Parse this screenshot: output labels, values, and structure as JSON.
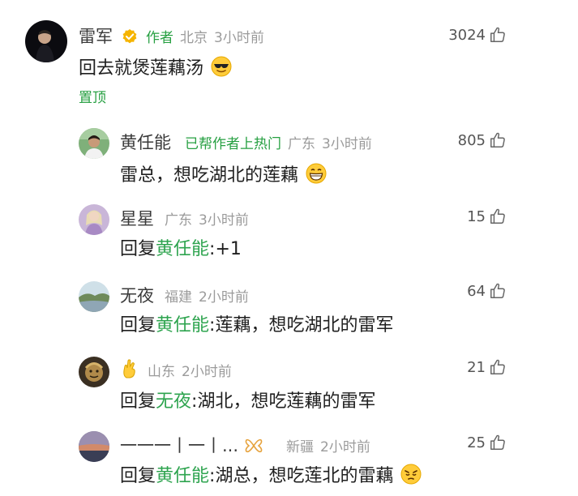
{
  "comments": [
    {
      "name": "雷军",
      "tag": "作者",
      "location": "北京",
      "time": "3小时前",
      "text": "回去就煲莲藕汤",
      "likes": "3024",
      "pin": "置顶"
    },
    {
      "name": "黄任能",
      "tag": "已帮作者上热门",
      "location": "广东",
      "time": "3小时前",
      "text": "雷总，想吃湖北的莲藕",
      "likes": "805"
    },
    {
      "name": "星星",
      "location": "广东",
      "time": "3小时前",
      "reply_prefix": "回复",
      "reply_to": "黄任能",
      "reply_text": ":+1",
      "likes": "15"
    },
    {
      "name": "无夜",
      "location": "福建",
      "time": "2小时前",
      "reply_prefix": "回复",
      "reply_to": "黄任能",
      "reply_text": ":莲藕，想吃湖北的雷军",
      "likes": "64"
    },
    {
      "name": "",
      "location": "山东",
      "time": "2小时前",
      "reply_prefix": "回复",
      "reply_to": "无夜",
      "reply_text": ":湖北，想吃莲藕的雷军",
      "likes": "21"
    },
    {
      "name": "一一一丨一丨...",
      "location": "新疆",
      "time": "2小时前",
      "reply_prefix": "回复",
      "reply_to": "黄任能",
      "reply_text": ":湖总，想吃莲北的雷藕",
      "likes": "25"
    }
  ],
  "icons": {
    "like": "thumbs-up-icon",
    "verified": "verified-badge-icon"
  },
  "colors": {
    "accent_green": "#27a042",
    "meta_gray": "#9b9b9b"
  }
}
